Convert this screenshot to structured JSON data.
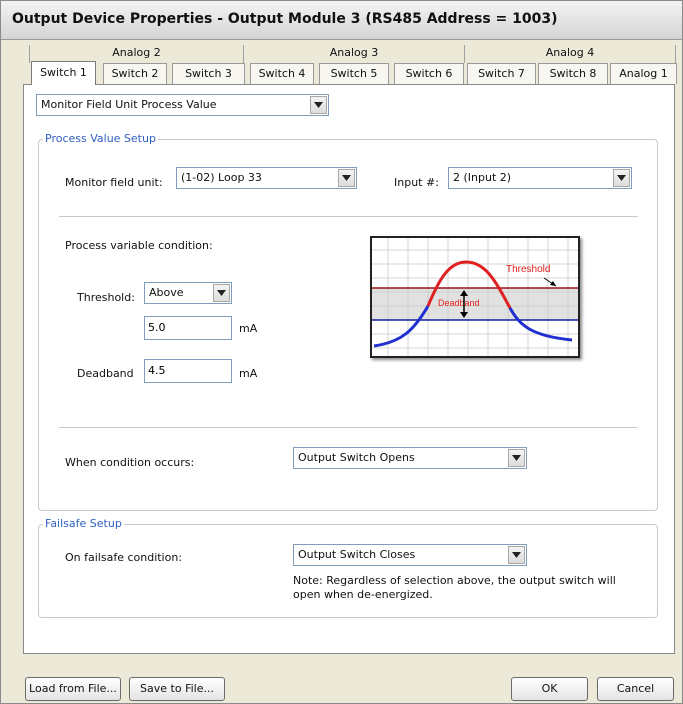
{
  "window": {
    "title": "Output Device Properties - Output Module 3 (RS485 Address = 1003)"
  },
  "tabs_back": [
    "Analog 2",
    "Analog 3",
    "Analog 4"
  ],
  "tabs_front": [
    "Switch 1",
    "Switch 2",
    "Switch 3",
    "Switch 4",
    "Switch 5",
    "Switch 6",
    "Switch 7",
    "Switch 8",
    "Analog 1"
  ],
  "active_tab": "Switch 1",
  "mode_select": {
    "value": "Monitor Field Unit Process Value"
  },
  "process_value_setup": {
    "title": "Process Value Setup",
    "monitor_label": "Monitor field unit:",
    "monitor_value": "(1-02) Loop 33",
    "input_label": "Input #:",
    "input_value": "2 (Input 2)",
    "condition_label": "Process variable condition:",
    "threshold_label": "Threshold:",
    "threshold_mode": "Above",
    "threshold_value": "5.0",
    "threshold_unit": "mA",
    "deadband_label": "Deadband",
    "deadband_value": "4.5",
    "deadband_unit": "mA",
    "diagram": {
      "threshold_text": "Threshold",
      "deadband_text": "Deadband",
      "colors": {
        "curve_hi": "#e02020",
        "curve_lo": "#2030d0",
        "threshold_line": "#a01010",
        "deadband_line": "#1020a0"
      }
    },
    "when_label": "When condition occurs:",
    "when_value": "Output Switch Opens"
  },
  "failsafe_setup": {
    "title": "Failsafe Setup",
    "on_label": "On failsafe condition:",
    "on_value": "Output Switch Closes",
    "note_line1": "Note: Regardless of selection above, the output switch will",
    "note_line2": "open when de-energized."
  },
  "buttons": {
    "load": "Load from File...",
    "save": "Save to File...",
    "ok": "OK",
    "cancel": "Cancel"
  }
}
